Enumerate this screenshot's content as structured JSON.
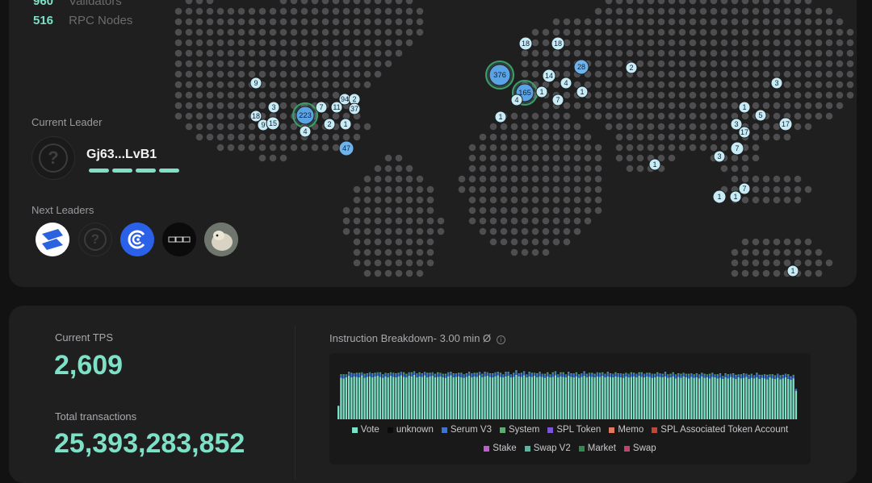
{
  "stats": {
    "validators": {
      "value": "960",
      "label": "Validators"
    },
    "rpc_nodes": {
      "value": "516",
      "label": "RPC Nodes"
    }
  },
  "current_leader": {
    "label": "Current Leader",
    "name": "Gj63...LvB1",
    "avatar_icon": "question-mark-icon"
  },
  "next_leaders": {
    "label": "Next Leaders",
    "avatars": [
      {
        "icon": "stake-s-logo",
        "color": "#2a62e0"
      },
      {
        "icon": "question-mark-icon",
        "color": "#1f1f20"
      },
      {
        "icon": "swirl-logo",
        "color": "#2b60e8"
      },
      {
        "icon": "ppo-logo",
        "color": "#0b0b0b"
      },
      {
        "icon": "animal-photo",
        "color": "#8a8f88"
      }
    ]
  },
  "map": {
    "clusters": [
      {
        "label": "18"
      },
      {
        "label": "18"
      },
      {
        "label": "376"
      },
      {
        "label": "28"
      },
      {
        "label": "2"
      },
      {
        "label": "14"
      },
      {
        "label": "4"
      },
      {
        "label": "165"
      },
      {
        "label": "1"
      },
      {
        "label": "7"
      },
      {
        "label": "1"
      },
      {
        "label": "4"
      },
      {
        "label": "1"
      },
      {
        "label": "3"
      },
      {
        "label": "17"
      },
      {
        "label": "3"
      },
      {
        "label": "7"
      },
      {
        "label": "223"
      },
      {
        "label": "7"
      },
      {
        "label": "11"
      },
      {
        "label": "94"
      },
      {
        "label": "2"
      },
      {
        "label": "37"
      },
      {
        "label": "9"
      },
      {
        "label": "9"
      },
      {
        "label": "15"
      },
      {
        "label": "2"
      },
      {
        "label": "1"
      },
      {
        "label": "4"
      },
      {
        "label": "47"
      },
      {
        "label": "1"
      },
      {
        "label": "5"
      },
      {
        "label": "17"
      },
      {
        "label": "3"
      },
      {
        "label": "1"
      },
      {
        "label": "7"
      },
      {
        "label": "1"
      },
      {
        "label": "1"
      },
      {
        "label": "18"
      },
      {
        "label": "3"
      },
      {
        "label": "1"
      }
    ]
  },
  "tps": {
    "current_label": "Current TPS",
    "current_value": "2,609",
    "total_label": "Total transactions",
    "total_value": "25,393,283,852"
  },
  "instruction_breakdown": {
    "title": "Instruction Breakdown- 3.00 min Ø",
    "info_icon": "info-icon",
    "legend_row1": [
      {
        "label": "Vote",
        "color": "#7ee0c7"
      },
      {
        "label": "unknown",
        "color": "#0b0b0b"
      },
      {
        "label": "Serum V3",
        "color": "#3b74d6"
      },
      {
        "label": "System",
        "color": "#5cae6e"
      },
      {
        "label": "SPL Token",
        "color": "#7d56d6"
      },
      {
        "label": "Memo",
        "color": "#e07a5f"
      },
      {
        "label": "SPL Associated Token Account",
        "color": "#c0453a"
      }
    ],
    "legend_row2": [
      {
        "label": "Stake",
        "color": "#c25bd1"
      },
      {
        "label": "Swap V2",
        "color": "#5ab5a0"
      },
      {
        "label": "Market",
        "color": "#2f8a4e"
      },
      {
        "label": "Swap",
        "color": "#c2446a"
      }
    ],
    "chart_data": {
      "type": "bar",
      "stacked": true,
      "series": [
        {
          "name": "Vote",
          "values": [
            0.27,
            0.83,
            0.82,
            0.84,
            0.87,
            0.84,
            0.86,
            0.85,
            0.84,
            0.88,
            0.83,
            0.85,
            0.86,
            0.84,
            0.86,
            0.87,
            0.85,
            0.83,
            0.86,
            0.84,
            0.87,
            0.85,
            0.84,
            0.86,
            0.88,
            0.85,
            0.84,
            0.87,
            0.86,
            0.89,
            0.84,
            0.86,
            0.85,
            0.88,
            0.84,
            0.86,
            0.87,
            0.84,
            0.85,
            0.86,
            0.84,
            0.83,
            0.86,
            0.88,
            0.84,
            0.85,
            0.86,
            0.84,
            0.83,
            0.85,
            0.87,
            0.84,
            0.86,
            0.85,
            0.88,
            0.84,
            0.86,
            0.87,
            0.85,
            0.84,
            0.86,
            0.88,
            0.85,
            0.84,
            0.86,
            0.87,
            0.84,
            0.85,
            0.89,
            0.86,
            0.85,
            0.88,
            0.84,
            0.86,
            0.85,
            0.87,
            0.84,
            0.86,
            0.85,
            0.83,
            0.86,
            0.84,
            0.85,
            0.88,
            0.84,
            0.86,
            0.85,
            0.84,
            0.87,
            0.85,
            0.84,
            0.86,
            0.83,
            0.85,
            0.87,
            0.84,
            0.86,
            0.85,
            0.84,
            0.86,
            0.85,
            0.87,
            0.84,
            0.86,
            0.85,
            0.84,
            0.86,
            0.85,
            0.84,
            0.83,
            0.86,
            0.84,
            0.85,
            0.86,
            0.84,
            0.87,
            0.85,
            0.84,
            0.86,
            0.85,
            0.83,
            0.84,
            0.86,
            0.85,
            0.84,
            0.86,
            0.83,
            0.84,
            0.86,
            0.82,
            0.85,
            0.83,
            0.86,
            0.84,
            0.82,
            0.85,
            0.83,
            0.84,
            0.82,
            0.86,
            0.83,
            0.84,
            0.82,
            0.85,
            0.84,
            0.82,
            0.83,
            0.81,
            0.84,
            0.82,
            0.85,
            0.83,
            0.81,
            0.84,
            0.82,
            0.83,
            0.85,
            0.81,
            0.83,
            0.82,
            0.84,
            0.81,
            0.83,
            0.82,
            0.8,
            0.84,
            0.82,
            0.81,
            0.83,
            0.8,
            0.82,
            0.84,
            0.81,
            0.79,
            0.82,
            0.57
          ]
        },
        {
          "name": "Serum V3",
          "values": [
            0.0,
            0.05,
            0.06,
            0.05,
            0.06,
            0.07,
            0.05,
            0.06,
            0.07,
            0.05,
            0.06,
            0.05,
            0.07,
            0.06,
            0.05,
            0.06,
            0.07,
            0.05,
            0.06,
            0.06,
            0.05,
            0.07,
            0.06,
            0.05,
            0.06,
            0.07,
            0.05,
            0.06,
            0.06,
            0.05,
            0.07,
            0.06,
            0.05,
            0.06,
            0.07,
            0.05,
            0.06,
            0.05,
            0.07,
            0.06,
            0.05,
            0.06,
            0.07,
            0.05,
            0.06,
            0.06,
            0.05,
            0.07,
            0.06,
            0.05,
            0.06,
            0.07,
            0.05,
            0.06,
            0.06,
            0.05,
            0.07,
            0.06,
            0.05,
            0.06,
            0.07,
            0.05,
            0.06,
            0.05,
            0.07,
            0.06,
            0.05,
            0.06,
            0.07,
            0.05,
            0.06,
            0.06,
            0.05,
            0.07,
            0.06,
            0.05,
            0.06,
            0.07,
            0.05,
            0.06,
            0.06,
            0.05,
            0.07,
            0.06,
            0.05,
            0.06,
            0.07,
            0.05,
            0.06,
            0.05,
            0.07,
            0.06,
            0.05,
            0.06,
            0.07,
            0.05,
            0.06,
            0.06,
            0.05,
            0.07,
            0.06,
            0.05,
            0.06,
            0.07,
            0.05,
            0.06,
            0.06,
            0.05,
            0.07,
            0.06,
            0.05,
            0.06,
            0.07,
            0.05,
            0.06,
            0.05,
            0.07,
            0.06,
            0.05,
            0.06,
            0.07,
            0.05,
            0.06,
            0.06,
            0.05,
            0.07,
            0.06,
            0.05,
            0.06,
            0.07,
            0.05,
            0.06,
            0.06,
            0.05,
            0.07,
            0.06,
            0.05,
            0.06,
            0.07,
            0.05,
            0.06,
            0.05,
            0.07,
            0.06,
            0.05,
            0.06,
            0.07,
            0.05,
            0.06,
            0.06,
            0.05,
            0.07,
            0.06,
            0.05,
            0.06,
            0.07,
            0.05,
            0.06,
            0.06,
            0.05,
            0.07,
            0.06,
            0.05,
            0.06,
            0.07,
            0.05,
            0.06,
            0.05,
            0.07,
            0.06,
            0.05,
            0.06,
            0.07,
            0.05,
            0.06,
            0.04
          ]
        },
        {
          "name": "System",
          "values": [
            0.0,
            0.02,
            0.02,
            0.01,
            0.02,
            0.02,
            0.01,
            0.02,
            0.02,
            0.01,
            0.02,
            0.02,
            0.01,
            0.02,
            0.02,
            0.01,
            0.02,
            0.02,
            0.01,
            0.02,
            0.02,
            0.01,
            0.02,
            0.02,
            0.01,
            0.02,
            0.02,
            0.01,
            0.02,
            0.02,
            0.01,
            0.02,
            0.02,
            0.01,
            0.02,
            0.02,
            0.01,
            0.02,
            0.02,
            0.01,
            0.02,
            0.02,
            0.01,
            0.02,
            0.02,
            0.01,
            0.02,
            0.02,
            0.01,
            0.02,
            0.02,
            0.01,
            0.02,
            0.02,
            0.01,
            0.02,
            0.02,
            0.01,
            0.02,
            0.02,
            0.01,
            0.02,
            0.02,
            0.01,
            0.02,
            0.02,
            0.01,
            0.02,
            0.02,
            0.01,
            0.02,
            0.02,
            0.01,
            0.02,
            0.02,
            0.01,
            0.02,
            0.02,
            0.01,
            0.02,
            0.02,
            0.01,
            0.02,
            0.02,
            0.01,
            0.02,
            0.02,
            0.01,
            0.02,
            0.02,
            0.01,
            0.02,
            0.02,
            0.01,
            0.02,
            0.02,
            0.01,
            0.02,
            0.02,
            0.01,
            0.02,
            0.02,
            0.01,
            0.02,
            0.02,
            0.01,
            0.02,
            0.02,
            0.01,
            0.02,
            0.02,
            0.01,
            0.02,
            0.02,
            0.01,
            0.02,
            0.02,
            0.01,
            0.02,
            0.02,
            0.01,
            0.02,
            0.02,
            0.01,
            0.02,
            0.02,
            0.01,
            0.02,
            0.02,
            0.01,
            0.02,
            0.02,
            0.01,
            0.02,
            0.02,
            0.01,
            0.02,
            0.02,
            0.01,
            0.02,
            0.02,
            0.01,
            0.02,
            0.02,
            0.01,
            0.02,
            0.02,
            0.01,
            0.02,
            0.02,
            0.01,
            0.02,
            0.02,
            0.01,
            0.02,
            0.02,
            0.01,
            0.02,
            0.02,
            0.01,
            0.02,
            0.02,
            0.01,
            0.02,
            0.02,
            0.01,
            0.02,
            0.02,
            0.01,
            0.02,
            0.02,
            0.01,
            0.02,
            0.02,
            0.01
          ]
        }
      ]
    }
  }
}
